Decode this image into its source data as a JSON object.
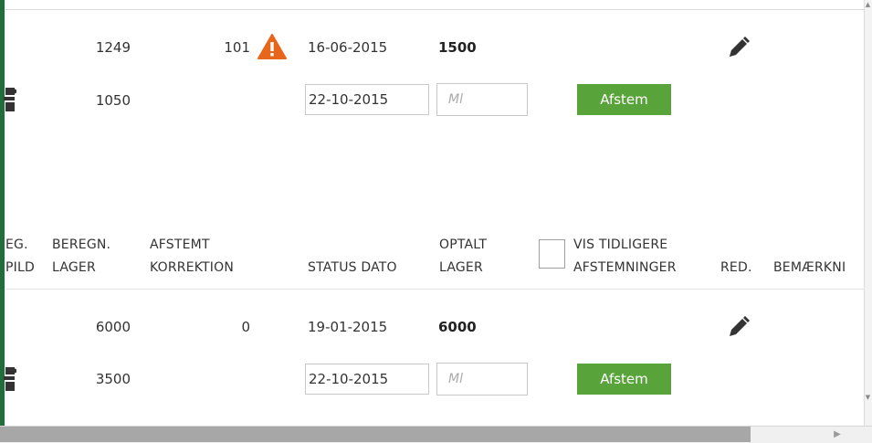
{
  "rows": [
    {
      "calc_stock": "1249",
      "correction": "101",
      "status_date": "16-06-2015",
      "counted_stock": "1500",
      "sub_value": "1050",
      "date_input_value": "22-10-2015",
      "ml_placeholder": "Ml",
      "afstem_label": "Afstem"
    },
    {
      "calc_stock": "6000",
      "correction": "0",
      "status_date": "19-01-2015",
      "counted_stock": "6000",
      "sub_value": "3500",
      "date_input_value": "22-10-2015",
      "ml_placeholder": "Ml",
      "afstem_label": "Afstem"
    }
  ],
  "header": {
    "col0_line1": "EG.",
    "col0_line2": "PILD",
    "col1_line1": "BEREGN.",
    "col1_line2": "LAGER",
    "col2_line1": "AFSTEMT",
    "col2_line2": "KORREKTION",
    "col3": "STATUS DATO",
    "col4_line1": "OPTALT",
    "col4_line2": "LAGER",
    "col5_line1": "VIS TIDLIGERE",
    "col5_line2": "AFSTEMNINGER",
    "col6": "RED.",
    "col7": "BEMÆRKNI"
  },
  "colors": {
    "accent_green": "#58a33a",
    "warning_orange": "#e8661c",
    "edge_green": "#1f6e3b"
  },
  "icons": {
    "warning": "warning-triangle-icon",
    "edit": "pencil-icon",
    "puzzle": "puzzle-icon"
  }
}
